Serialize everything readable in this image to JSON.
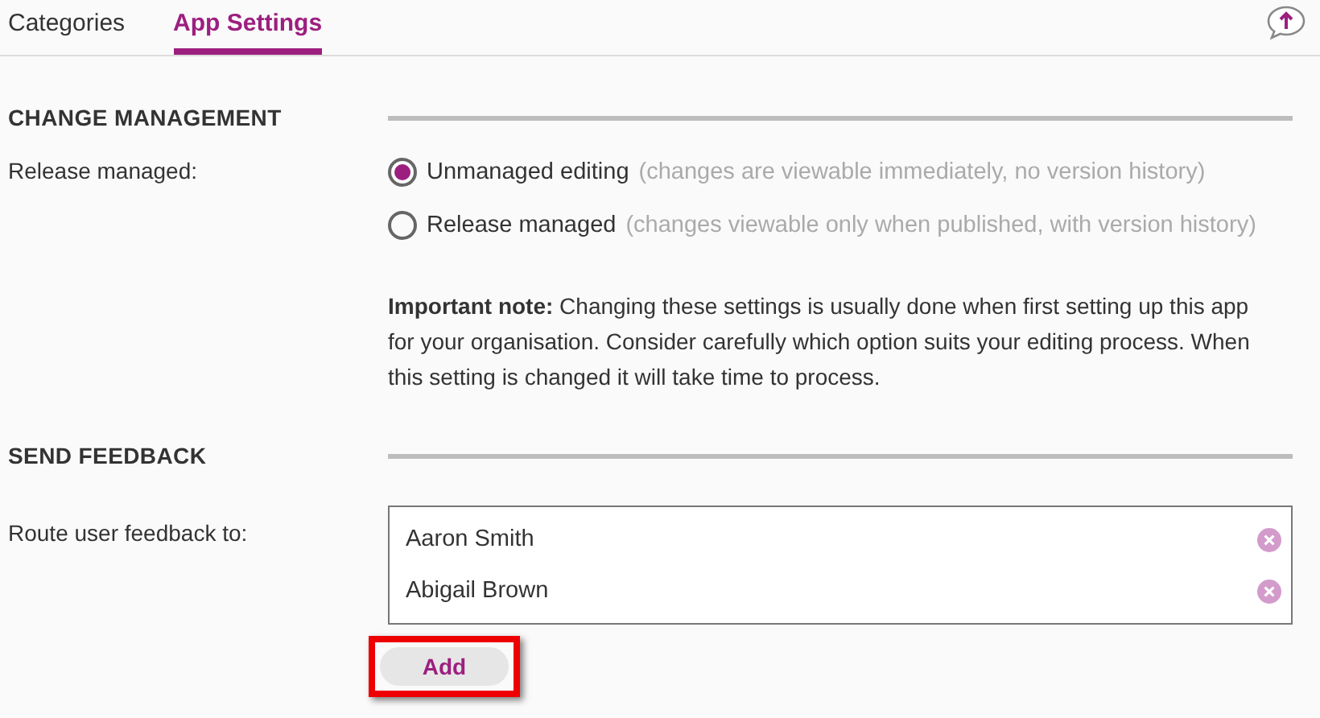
{
  "tabs": [
    {
      "label": "Categories",
      "selected": false
    },
    {
      "label": "App Settings",
      "selected": true
    }
  ],
  "sections": [
    {
      "kind": "radios",
      "heading": "CHANGE MANAGEMENT",
      "label": "Release managed:",
      "options": [
        {
          "label": "Unmanaged editing",
          "hint": "(changes are viewable immediately, no version history)",
          "selected": true
        },
        {
          "label": "Release managed",
          "hint": "(changes viewable only when published, with version history)",
          "selected": false
        }
      ],
      "note": "**Important note:** Changing these settings is usually done when first setting up this app for your organisation. Consider carefully which option suits your editing process. When this setting is changed it will take time to process."
    },
    {
      "kind": "people",
      "heading": "SEND FEEDBACK",
      "label": "Route user feedback to:",
      "people": [
        "Aaron Smith",
        "Abigail Brown"
      ],
      "button": {
        "label": "Add",
        "highlighted": true
      }
    }
  ]
}
